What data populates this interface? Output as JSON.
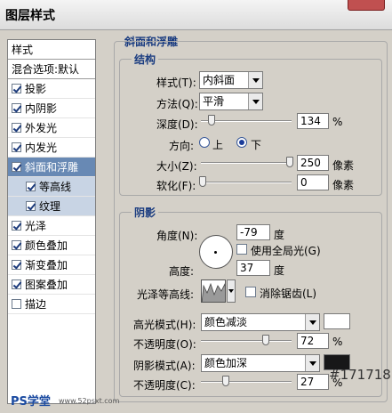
{
  "window": {
    "title": "图层样式"
  },
  "sidebar": {
    "header": "样式",
    "blend": "混合选项:默认",
    "items": [
      {
        "label": "投影",
        "checked": true
      },
      {
        "label": "内阴影",
        "checked": true
      },
      {
        "label": "外发光",
        "checked": true
      },
      {
        "label": "内发光",
        "checked": true
      },
      {
        "label": "斜面和浮雕",
        "checked": true,
        "selected": true
      },
      {
        "label": "等高线",
        "checked": true,
        "sub": true
      },
      {
        "label": "纹理",
        "checked": true,
        "sub": true
      },
      {
        "label": "光泽",
        "checked": true
      },
      {
        "label": "颜色叠加",
        "checked": true
      },
      {
        "label": "渐变叠加",
        "checked": true
      },
      {
        "label": "图案叠加",
        "checked": true
      },
      {
        "label": "描边",
        "checked": false
      }
    ]
  },
  "bevel": {
    "section_title": "斜面和浮雕",
    "structure": {
      "title": "结构",
      "style_label": "样式(T):",
      "style_value": "内斜面",
      "technique_label": "方法(Q):",
      "technique_value": "平滑",
      "depth_label": "深度(D):",
      "depth_value": "134",
      "depth_unit": "%",
      "direction_label": "方向:",
      "dir_up": "上",
      "dir_down": "下",
      "direction_selected": "down",
      "size_label": "大小(Z):",
      "size_value": "250",
      "size_unit": "像素",
      "soften_label": "软化(F):",
      "soften_value": "0",
      "soften_unit": "像素"
    },
    "shading": {
      "title": "阴影",
      "angle_label": "角度(N):",
      "angle_value": "-79",
      "angle_unit": "度",
      "global_light_label": "使用全局光(G)",
      "altitude_label": "高度:",
      "altitude_value": "37",
      "altitude_unit": "度",
      "gloss_contour_label": "光泽等高线:",
      "antialias_label": "消除锯齿(L)",
      "highlight_mode_label": "高光模式(H):",
      "highlight_mode_value": "颜色减淡",
      "highlight_color": "#ffffff",
      "highlight_opacity_label": "不透明度(O):",
      "highlight_opacity_value": "72",
      "highlight_opacity_unit": "%",
      "shadow_mode_label": "阴影模式(A):",
      "shadow_mode_value": "颜色加深",
      "shadow_color": "#171718",
      "shadow_color_text": "#171718",
      "shadow_opacity_label": "不透明度(C):",
      "shadow_opacity_value": "27",
      "shadow_opacity_unit": "%"
    }
  },
  "watermark": {
    "left": "PS学堂",
    "site": "www.52psxt.com"
  }
}
